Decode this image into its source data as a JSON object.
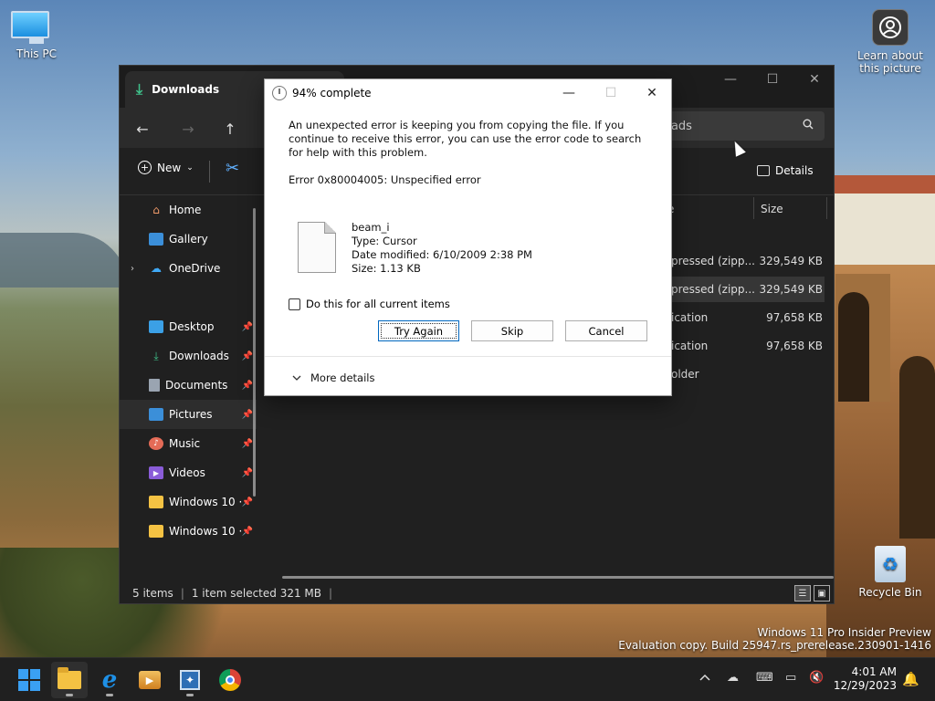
{
  "desktop": {
    "this_pc": "This PC",
    "learn_line1": "Learn about",
    "learn_line2": "this picture",
    "recycle_bin": "Recycle Bin",
    "watermark_line1": "Windows 11 Pro Insider Preview",
    "watermark_line2": "Evaluation copy. Build 25947.rs_prerelease.230901-1416"
  },
  "explorer": {
    "tab_title": "Downloads",
    "search_placeholder": "oads",
    "toolbar": {
      "new_label": "New",
      "details_label": "Details"
    },
    "sidebar": {
      "home": "Home",
      "gallery": "Gallery",
      "onedrive": "OneDrive",
      "desktop": "Desktop",
      "downloads": "Downloads",
      "documents": "Documents",
      "pictures": "Pictures",
      "music": "Music",
      "videos": "Videos",
      "win10a": "Windows 10 ·",
      "win10b": "Windows 10 ·"
    },
    "columns": {
      "type": "e",
      "size": "Size"
    },
    "rows": [
      {
        "type": "pressed (zipp...",
        "size": "329,549 KB"
      },
      {
        "type": "pressed (zipp...",
        "size": "329,549 KB"
      },
      {
        "type": "ication",
        "size": "97,658 KB"
      },
      {
        "type": "ication",
        "size": "97,658 KB"
      },
      {
        "type": "older",
        "size": ""
      }
    ],
    "status": {
      "items": "5 items",
      "selected": "1 item selected  321 MB",
      "sep": "|"
    }
  },
  "dialog": {
    "title": "94% complete",
    "message": "An unexpected error is keeping you from copying the file. If you continue to receive this error, you can use the error code to search for help with this problem.",
    "error": "Error 0x80004005: Unspecified error",
    "file_name": "beam_i",
    "file_type": "Type: Cursor",
    "file_date": "Date modified: 6/10/2009 2:38 PM",
    "file_size": "Size: 1.13 KB",
    "checkbox_label": "Do this for all current items",
    "btn_try_again": "Try Again",
    "btn_skip": "Skip",
    "btn_cancel": "Cancel",
    "more_details": "More details"
  },
  "taskbar": {
    "time": "4:01 AM",
    "date": "12/29/2023"
  }
}
